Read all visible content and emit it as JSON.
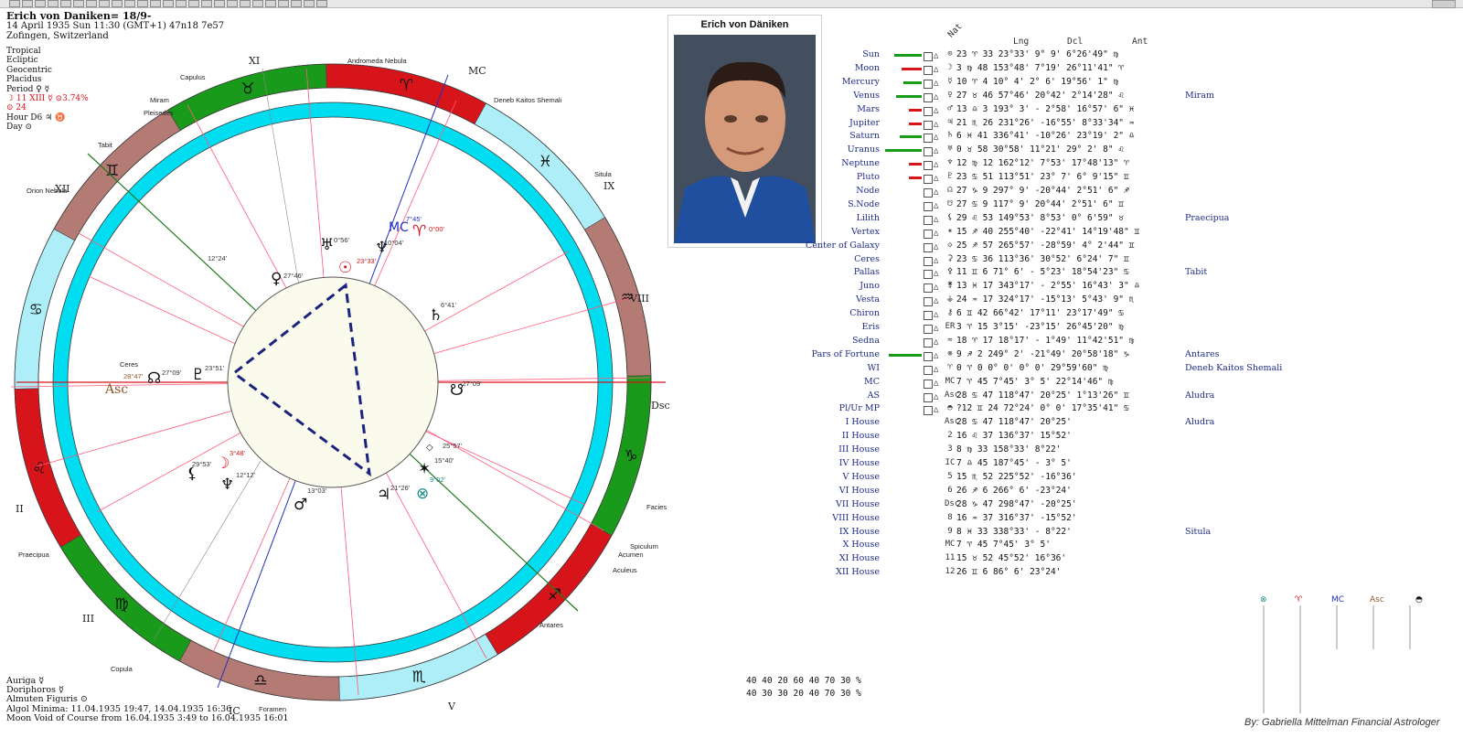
{
  "header": {
    "title": "Erich von Daniken= 18/9-",
    "line2": "14 April 1935  Sun  11:30 (GMT+1) 47n18  7e57",
    "line3": "Zofingen, Switzerland"
  },
  "left_info": {
    "l1": "Tropical",
    "l2": "Ecliptic",
    "l3": "Geocentric",
    "l4": "Placidus",
    "l5": "Period  ♀ ☿",
    "l6": "☽ 11 XIII  ☿  ⊙3.74%",
    "l7": "⊙ 24",
    "l8": "Hour D6 ♃ ♉",
    "l9": "Day  ⊙"
  },
  "footer": {
    "l1": "Auriga  ☿",
    "l2": "Doriphoros  ☿",
    "l3": "Almuten Figuris  ⊙",
    "l4": "Algol Minima: 11.04.1935 19:47,  14.04.1935 16:36",
    "l5": "Moon Void of Course from 16.04.1935  3:49 to 16.04.1935 16:01"
  },
  "photo": {
    "caption": "Erich von Däniken"
  },
  "wheel": {
    "house_labels": [
      "XI",
      "IX",
      "VIII",
      "Dsc",
      "V",
      "IC",
      "III",
      "II",
      "XII",
      "Asc",
      "MC"
    ],
    "stars": [
      "Andromeda Nebula",
      "Deneb Kaitos Shemali",
      "Situla",
      "Capulus",
      "Miram",
      "Pleisedes",
      "Tabit",
      "Orion Nebula",
      "Antares",
      "Spiculum",
      "Acumen",
      "Aculeus",
      "Facies",
      "Praecipua",
      "Copula",
      "Foramen",
      "Ceres"
    ],
    "planet_labels": [
      "0°56'",
      "10°04'",
      "7°45'",
      "0°00'",
      "23°33'",
      "27°46'",
      "6°41'",
      "-27°09'",
      "23°51'",
      "27°09'",
      "28°47'",
      "3°48'",
      "29°53'",
      "12°12'",
      "13°03'",
      "21°26'",
      "9°02'",
      "15°40'",
      "25°57'",
      "12°24'"
    ]
  },
  "table": {
    "headers": {
      "nat": "Nat",
      "lng": "Lng",
      "dcl": "Dcl",
      "ant": "Ant"
    },
    "rows": [
      {
        "name": "Sun",
        "sym": "⊙",
        "data": "23 ♈ 33   23°33'    9° 9'   6°26'49\" ♍",
        "extra": ""
      },
      {
        "name": "Moon",
        "sym": "☽",
        "data": " 3 ♍ 48  153°48'    7°19'  26°11'41\" ♈",
        "extra": ""
      },
      {
        "name": "Mercury",
        "sym": "☿",
        "data": "10 ♈  4   10° 4'    2° 6'  19°56' 1\" ♍",
        "extra": ""
      },
      {
        "name": "Venus",
        "sym": "♀",
        "data": "27 ♉ 46   57°46'   20°42'   2°14'28\" ♌",
        "extra": "Miram"
      },
      {
        "name": "Mars",
        "sym": "♂",
        "data": "13 ♎  3  193° 3'  - 2°58'  16°57' 6\" ♓",
        "extra": ""
      },
      {
        "name": "Jupiter",
        "sym": "♃",
        "data": "21 ♏ 26  231°26'  -16°55'   8°33'34\" ♒",
        "extra": ""
      },
      {
        "name": "Saturn",
        "sym": "♄",
        "data": " 6 ♓ 41  336°41'  -10°26'  23°19' 2\" ♎",
        "extra": ""
      },
      {
        "name": "Uranus",
        "sym": "♅",
        "data": " 0 ♉ 58   30°58'   11°21'  29° 2' 8\" ♌",
        "extra": ""
      },
      {
        "name": "Neptune",
        "sym": "♆",
        "data": "12 ♍ 12  162°12'    7°53'  17°48'13\" ♈",
        "extra": ""
      },
      {
        "name": "Pluto",
        "sym": "♇",
        "data": "23 ♋ 51  113°51'   23° 7'   6° 9'15\" ♊",
        "extra": ""
      },
      {
        "name": "Node",
        "sym": "☊",
        "data": "27 ♑  9  297° 9'  -20°44'   2°51' 6\" ♐",
        "extra": ""
      },
      {
        "name": "S.Node",
        "sym": "☋",
        "data": "27 ♋  9  117° 9'   20°44'   2°51' 6\" ♊",
        "extra": ""
      },
      {
        "name": "Lilith",
        "sym": "⚸",
        "data": "29 ♌ 53  149°53'    8°53'   0° 6'59\" ♉",
        "extra": "Praecipua"
      },
      {
        "name": "Vertex",
        "sym": "✶",
        "data": "15 ♐ 40  255°40'  -22°41'  14°19'48\" ♊",
        "extra": ""
      },
      {
        "name": "Center of Galaxy",
        "sym": "◇",
        "data": "25 ♐ 57  265°57'  -28°59'   4° 2'44\" ♊",
        "extra": ""
      },
      {
        "name": "Ceres",
        "sym": "⚳",
        "data": "23 ♋ 36  113°36'   30°52'   6°24' 7\" ♊",
        "extra": ""
      },
      {
        "name": "Pallas",
        "sym": "⚴",
        "data": "11 ♊  6   71° 6'  - 5°23'  18°54'23\" ♋",
        "extra": "Tabit"
      },
      {
        "name": "Juno",
        "sym": "⚵",
        "data": "13 ♓ 17  343°17'  - 2°55'  16°43' 3\" ♎",
        "extra": ""
      },
      {
        "name": "Vesta",
        "sym": "⚶",
        "data": "24 ♒ 17  324°17'  -15°13'   5°43' 9\" ♏",
        "extra": ""
      },
      {
        "name": "Chiron",
        "sym": "⚷",
        "data": " 6 ♊ 42   66°42'   17°11'  23°17'49\" ♋",
        "extra": ""
      },
      {
        "name": "Eris",
        "sym": "ER",
        "data": " 3 ♈ 15    3°15'  -23°15'  26°45'20\" ♍",
        "extra": ""
      },
      {
        "name": "Sedna",
        "sym": "≈",
        "data": "18 ♈ 17   18°17'  - 1°49'  11°42'51\" ♍",
        "extra": ""
      },
      {
        "name": "Pars of Fortune",
        "sym": "⊗",
        "data": " 9 ♐  2  249° 2'  -21°49'  20°58'18\" ♑",
        "extra": "Antares"
      },
      {
        "name": "WI",
        "sym": "♈",
        "data": " 0 ♈  0    0° 0'    0° 0'  29°59'60\" ♍",
        "extra": "Deneb Kaitos Shemali"
      },
      {
        "name": "MC",
        "sym": "MC",
        "data": " 7 ♈ 45    7°45'    3° 5'  22°14'46\" ♍",
        "extra": ""
      },
      {
        "name": "AS",
        "sym": "Asc",
        "data": "28 ♋ 47  118°47'   20°25'   1°13'26\" ♊",
        "extra": "Aludra"
      },
      {
        "name": "Pl/Ur MP",
        "sym": "◓",
        "data": "?12 ♊ 24   72°24'    0° 0'  17°35'41\" ♋",
        "extra": ""
      },
      {
        "name": "I House",
        "sym": "Asc",
        "data": "28 ♋ 47  118°47'   20°25'",
        "extra": "Aludra"
      },
      {
        "name": "II House",
        "sym": "2",
        "data": "16 ♌ 37  136°37'   15°52'",
        "extra": ""
      },
      {
        "name": "III House",
        "sym": "3",
        "data": " 8 ♍ 33  158°33'    8°22'",
        "extra": ""
      },
      {
        "name": "IV House",
        "sym": "IC",
        "data": " 7 ♎ 45  187°45'  - 3° 5'",
        "extra": ""
      },
      {
        "name": "V House",
        "sym": "5",
        "data": "15 ♏ 52  225°52'  -16°36'",
        "extra": ""
      },
      {
        "name": "VI House",
        "sym": "6",
        "data": "26 ♐  6  266° 6'  -23°24'",
        "extra": ""
      },
      {
        "name": "VII House",
        "sym": "Dsc",
        "data": "28 ♑ 47  298°47'  -20°25'",
        "extra": ""
      },
      {
        "name": "VIII House",
        "sym": "8",
        "data": "16 ♒ 37  316°37'  -15°52'",
        "extra": ""
      },
      {
        "name": "IX House",
        "sym": "9",
        "data": " 8 ♓ 33  338°33'  - 8°22'",
        "extra": "Situla"
      },
      {
        "name": "X House",
        "sym": "MC",
        "data": " 7 ♈ 45    7°45'    3° 5'",
        "extra": ""
      },
      {
        "name": "XI House",
        "sym": "11",
        "data": "15 ♉ 52   45°52'   16°36'",
        "extra": ""
      },
      {
        "name": "XII House",
        "sym": "12",
        "data": "26 ♊  6   86° 6'   23°24'",
        "extra": ""
      }
    ]
  },
  "stats": {
    "r1": "40 40 20    60 40 70 30 %",
    "r2": "40 30 30    20 40 70 30 %"
  },
  "credit": "By: Gabriella Mittelman Financial Astrologer"
}
